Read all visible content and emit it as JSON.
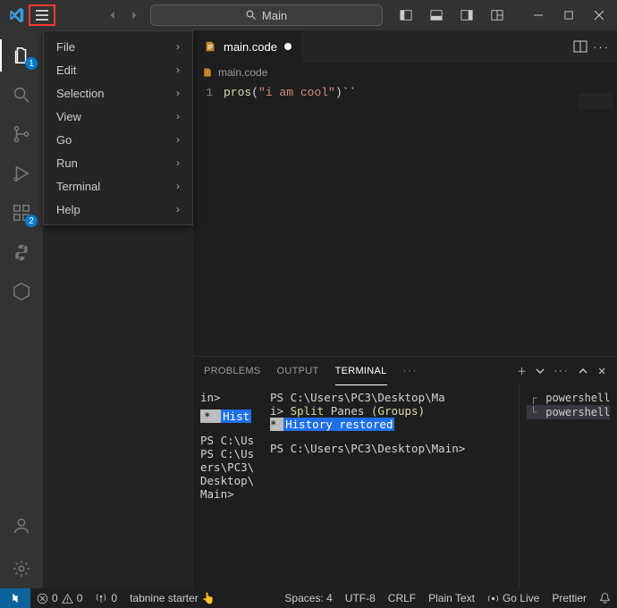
{
  "titlebar": {
    "search_text": "Main"
  },
  "menu": {
    "items": [
      {
        "label": "File",
        "submenu": true
      },
      {
        "label": "Edit",
        "submenu": true
      },
      {
        "label": "Selection",
        "submenu": true
      },
      {
        "label": "View",
        "submenu": true
      },
      {
        "label": "Go",
        "submenu": true
      },
      {
        "label": "Run",
        "submenu": true
      },
      {
        "label": "Terminal",
        "submenu": true
      },
      {
        "label": "Help",
        "submenu": true
      }
    ]
  },
  "activitybar": {
    "explorer_badge": "1",
    "ext_badge": "2"
  },
  "editor": {
    "tab_name": "main.code",
    "breadcrumb": "main.code",
    "line_number": "1",
    "code_fn": "pros",
    "code_paren_open": "(",
    "code_str": "\"i am cool\"",
    "code_tail": ")``"
  },
  "panel": {
    "tabs": {
      "problems": "PROBLEMS",
      "output": "OUTPUT",
      "terminal": "TERMINAL"
    },
    "left": {
      "l1": "in>",
      "hist_frag": "Hist",
      "l3a": "PS C:\\Us",
      "l3b": "PS C:\\Us",
      "l3c": "ers\\PC3\\",
      "l3d": "Desktop\\",
      "l3e": "Main>"
    },
    "mid": {
      "l1": "PS C:\\Users\\PC3\\Desktop\\Ma",
      "l2a": "i> ",
      "l2b": "Split",
      "l2c": " Panes ",
      "l2d": "(Groups)",
      "hist_star": " * ",
      "hist": "History restored",
      "l4": "PS C:\\Users\\PC3\\Desktop\\Main>"
    },
    "right": {
      "item1": "powershell",
      "item2": "powershell"
    }
  },
  "status": {
    "errors": "0",
    "warnings": "0",
    "ports": "0",
    "tabnine": "tabnine starter",
    "spaces": "Spaces: 4",
    "encoding": "UTF-8",
    "eol": "CRLF",
    "lang": "Plain Text",
    "golive": "Go Live",
    "prettier": "Prettier"
  }
}
